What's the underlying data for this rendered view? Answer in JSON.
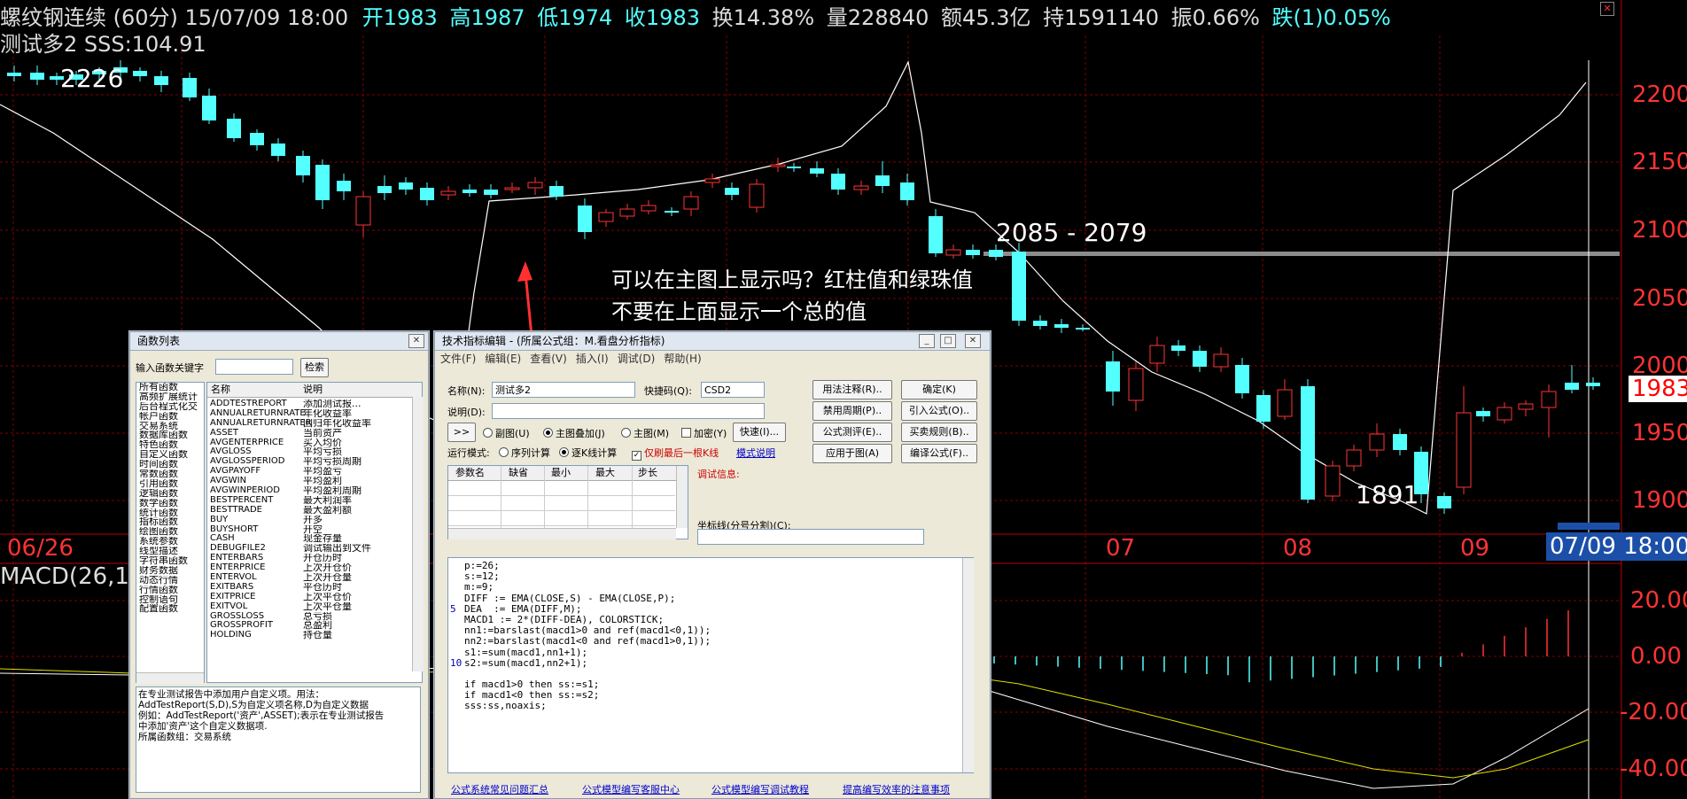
{
  "header": {
    "instrument": "螺纹钢连续 (60分) 15/07/09 18:00",
    "open": "开1983",
    "high": "高1987",
    "low": "低1974",
    "close": "收1983",
    "turnover": "换14.38%",
    "volume": "量228840",
    "amount": "额45.3亿",
    "hold": "持1591140",
    "amplitude": "振0.66%",
    "change": "跌(1)0.05%",
    "indicator_line": "测试多2 SSS:104.91"
  },
  "chart": {
    "label_2226": "2226",
    "label_1891": "1891",
    "label_range": "2085 - 2079",
    "annotation_line1": "可以在主图上显示吗？红柱值和绿珠值",
    "annotation_line2": "不要在上面显示一个总的值",
    "price_ticks": [
      "2200",
      "2150",
      "2100",
      "2050",
      "2000",
      "1950",
      "1900"
    ],
    "current_price": "1983",
    "date_ticks": [
      "06/26",
      "07",
      "08",
      "09"
    ],
    "cursor_date": "07/09 18:00",
    "macd_label": "MACD(26,1",
    "macd_ticks": [
      "20.00",
      "0.00",
      "-20.00",
      "-40.00"
    ],
    "colors": {
      "up": "#ff3333",
      "down": "#54ffff",
      "axis": "#c00000",
      "macd_dea": "#e0e000"
    }
  },
  "func_dialog": {
    "title": "函数列表",
    "search_label": "输入函数关键字",
    "search_value": "",
    "search_button": "检索",
    "categories": [
      "所有函数",
      "高频扩展统计",
      "后台程式化交",
      "帐户函数",
      "交易系统",
      "数据库函数",
      "特色函数",
      "自定义函数",
      "时间函数",
      "常数函数",
      "引用函数",
      "逻辑函数",
      "数学函数",
      "统计函数",
      "指标函数",
      "绘图函数",
      "系统参数",
      "线型描述",
      "字符串函数",
      "财务数据",
      "动态行情",
      "行情函数",
      "控制语句",
      "配置函数"
    ],
    "col_name": "名称",
    "col_desc": "说明",
    "functions": [
      [
        "ADDTESTREPORT",
        "添加测试报..."
      ],
      [
        "ANNUALRETURNRATE",
        "年化收益率"
      ],
      [
        "ANNUALRETURNRATER",
        "回归年化收益率"
      ],
      [
        "ASSET",
        "当前资产"
      ],
      [
        "AVGENTERPRICE",
        "买入均价"
      ],
      [
        "AVGLOSS",
        "平均亏损"
      ],
      [
        "AVGLOSSPERIOD",
        "平均亏损周期"
      ],
      [
        "AVGPAYOFF",
        "平均盈亏"
      ],
      [
        "AVGWIN",
        "平均盈利"
      ],
      [
        "AVGWINPERIOD",
        "平均盈利周期"
      ],
      [
        "BESTPERCENT",
        "最大利润率"
      ],
      [
        "BESTTRADE",
        "最大盈利额"
      ],
      [
        "BUY",
        "开多"
      ],
      [
        "BUYSHORT",
        "开空"
      ],
      [
        "CASH",
        "现金存量"
      ],
      [
        "DEBUGFILE2",
        "调试输出到文件"
      ],
      [
        "ENTERBARS",
        "开仓历时"
      ],
      [
        "ENTERPRICE",
        "上次开仓价"
      ],
      [
        "ENTERVOL",
        "上次开仓量"
      ],
      [
        "EXITBARS",
        "平仓历时"
      ],
      [
        "EXITPRICE",
        "上次平仓价"
      ],
      [
        "EXITVOL",
        "上次平仓量"
      ],
      [
        "GROSSLOSS",
        "总亏损"
      ],
      [
        "GROSSPROFIT",
        "总盈利"
      ],
      [
        "HOLDING",
        "持仓量"
      ]
    ],
    "help_lines": [
      "在专业测试报告中添加用户自定义项。用法：",
      "AddTestReport(S,D),S为自定义项名称,D为自定义数据",
      "例如：AddTestReport('资产',ASSET);表示在专业测试报告",
      "中添加'资产'这个自定义数据项.",
      "所属函数组：交易系统"
    ]
  },
  "editor_dialog": {
    "title": "技术指标编辑 - (所属公式组：M.看盘分析指标)",
    "menu": [
      "文件(F)",
      "编辑(E)",
      "查看(V)",
      "插入(I)",
      "调试(D)",
      "帮助(H)"
    ],
    "name_label": "名称(N):",
    "name_value": "测试多2",
    "code_label": "快捷码(Q):",
    "code_value": "CSD2",
    "desc_label": "说明(D):",
    "desc_value": "",
    "more_button": ">>",
    "radio_sub": "副图(U)",
    "radio_overlay": "主图叠加(J)",
    "radio_main": "主图(M)",
    "check_encrypt": "加密(Y)",
    "quick_button": "快速(I)...",
    "run_mode_label": "运行模式:",
    "radio_seq": "序列计算",
    "radio_line": "逐K线计算",
    "check_last": "仅刷最后一根K线",
    "mode_help": "模式说明",
    "buttons": [
      "用法注释(R)..",
      "确定(K)",
      "禁用周期(P)..",
      "引入公式(O)..",
      "公式测评(E)..",
      "买卖规则(B)..",
      "应用于图(A)",
      "编译公式(F).."
    ],
    "param_headers": [
      "参数名",
      "缺省",
      "最小",
      "最大",
      "步长"
    ],
    "debug_label": "调试信息:",
    "coord_label": "坐标线(分号分割)(C):",
    "code_lines": [
      "p:=26;",
      "s:=12;",
      "m:=9;",
      "DIFF := EMA(CLOSE,S) - EMA(CLOSE,P);",
      "DEA  := EMA(DIFF,M);",
      "MACD1 := 2*(DIFF-DEA), COLORSTICK;",
      "nn1:=barslast(macd1>0 and ref(macd1<0,1));",
      "nn2:=barslast(macd1<0 and ref(macd1>0,1));",
      "s1:=sum(macd1,nn1+1);",
      "s2:=sum(macd1,nn2+1);",
      "",
      "if macd1>0 then ss:=s1;",
      "if macd1<0 then ss:=s2;",
      "sss:ss,noaxis;"
    ],
    "line_no_5": "5",
    "line_no_10": "10",
    "footer_links": [
      "公式系统常见问题汇总",
      "公式模型编写客服中心",
      "公式模型编写调试教程",
      "提高编写效率的注意事项"
    ]
  }
}
